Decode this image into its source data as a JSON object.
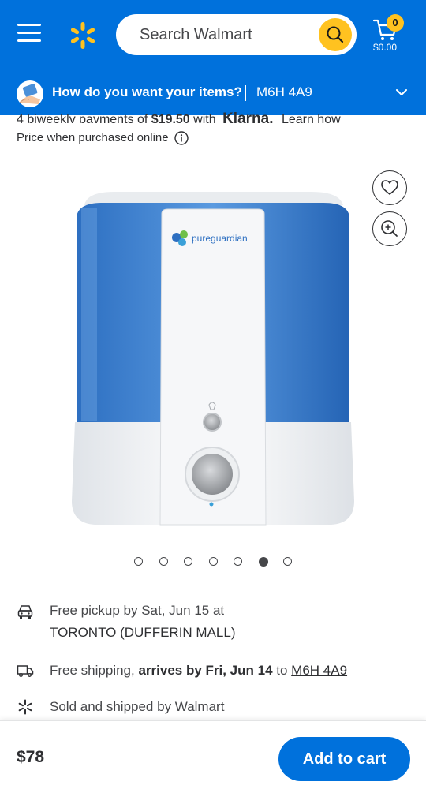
{
  "header": {
    "search_placeholder": "Search Walmart",
    "cart_count": "0",
    "cart_total": "$0.00",
    "colors": {
      "brand_blue": "#0071dc",
      "spark_yellow": "#ffc220"
    }
  },
  "delivery": {
    "question": "How do you want your items?",
    "postal_code": "M6H 4A9"
  },
  "payments": {
    "prefix": "4 biweekly payments of",
    "amount": "$19.50",
    "with": "with",
    "provider": "Klarna.",
    "learn_more": "Learn how"
  },
  "price_note": "Price when purchased online",
  "product": {
    "brand_text": "pureguardian",
    "image_count": 7,
    "active_image_index": 6
  },
  "fulfillment": {
    "pickup_text": "Free pickup by Sat, Jun 15 at",
    "pickup_store": "TORONTO (DUFFERIN MALL)",
    "shipping_prefix": "Free shipping, ",
    "shipping_bold": "arrives by Fri, Jun 14",
    "shipping_to": " to ",
    "shipping_code": "M6H 4A9",
    "sold_by": "Sold and shipped by Walmart"
  },
  "bottom": {
    "price": "$78",
    "add_to_cart": "Add to cart"
  }
}
